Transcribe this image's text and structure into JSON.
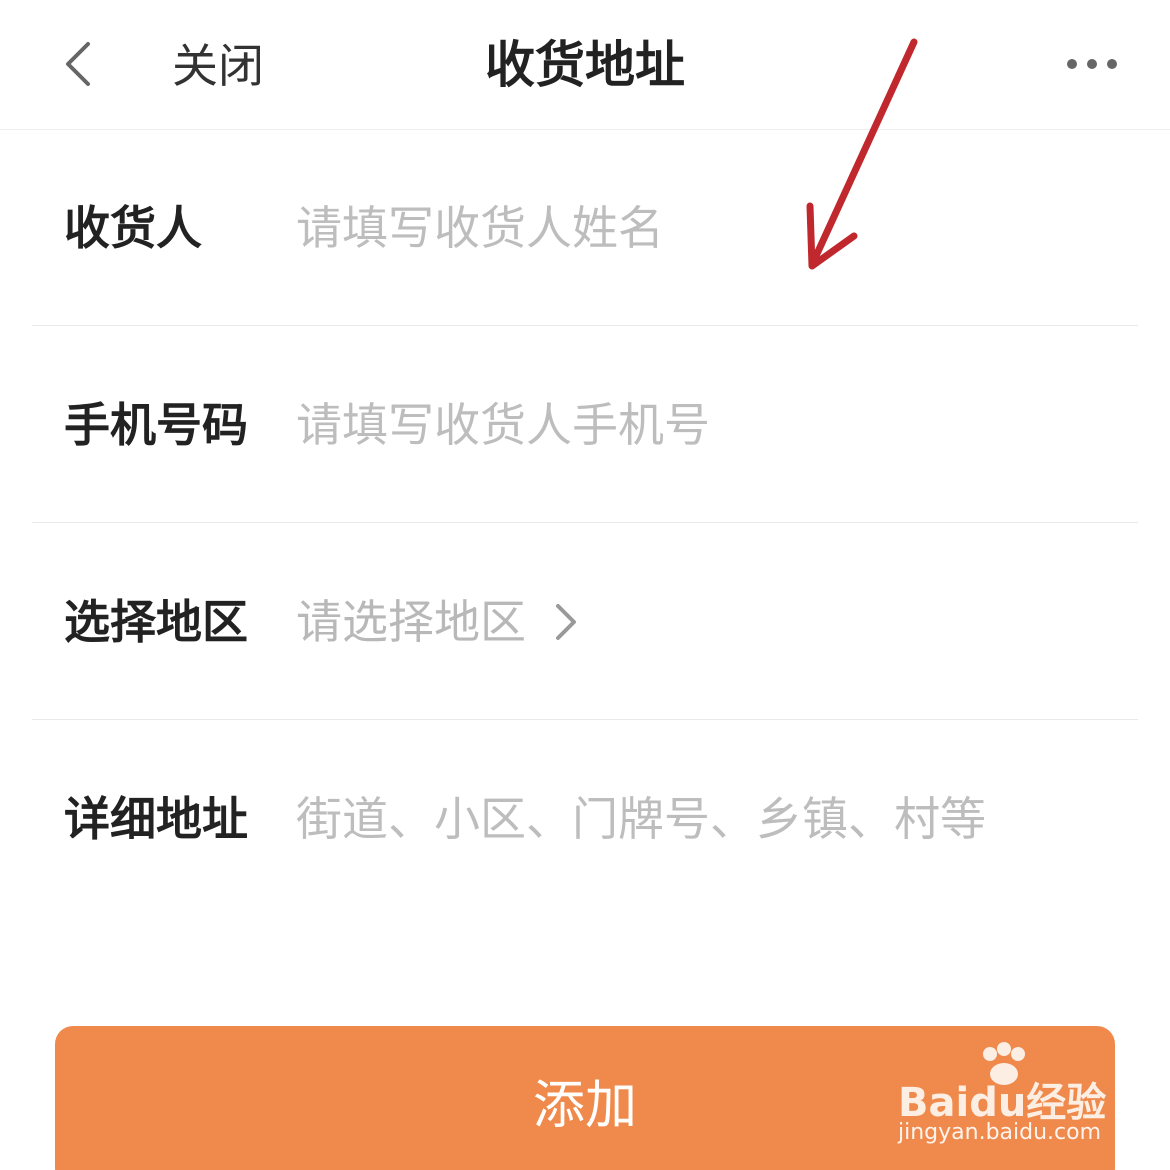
{
  "header": {
    "close_label": "关闭",
    "title": "收货地址"
  },
  "form": {
    "name": {
      "label": "收货人",
      "placeholder": "请填写收货人姓名"
    },
    "phone": {
      "label": "手机号码",
      "placeholder": "请填写收货人手机号"
    },
    "region": {
      "label": "选择地区",
      "placeholder": "请选择地区"
    },
    "detail": {
      "label": "详细地址",
      "placeholder": "街道、小区、门牌号、乡镇、村等"
    }
  },
  "actions": {
    "add_label": "添加"
  },
  "watermark": {
    "logo_text": "Baidu经验",
    "url": "jingyan.baidu.com"
  },
  "colors": {
    "accent": "#ef8a4c",
    "annotation": "#c0282d",
    "placeholder": "#bdbdbd"
  },
  "icons": {
    "back": "chevron-left-icon",
    "more": "more-dots-icon",
    "region_chevron": "chevron-right-icon"
  }
}
